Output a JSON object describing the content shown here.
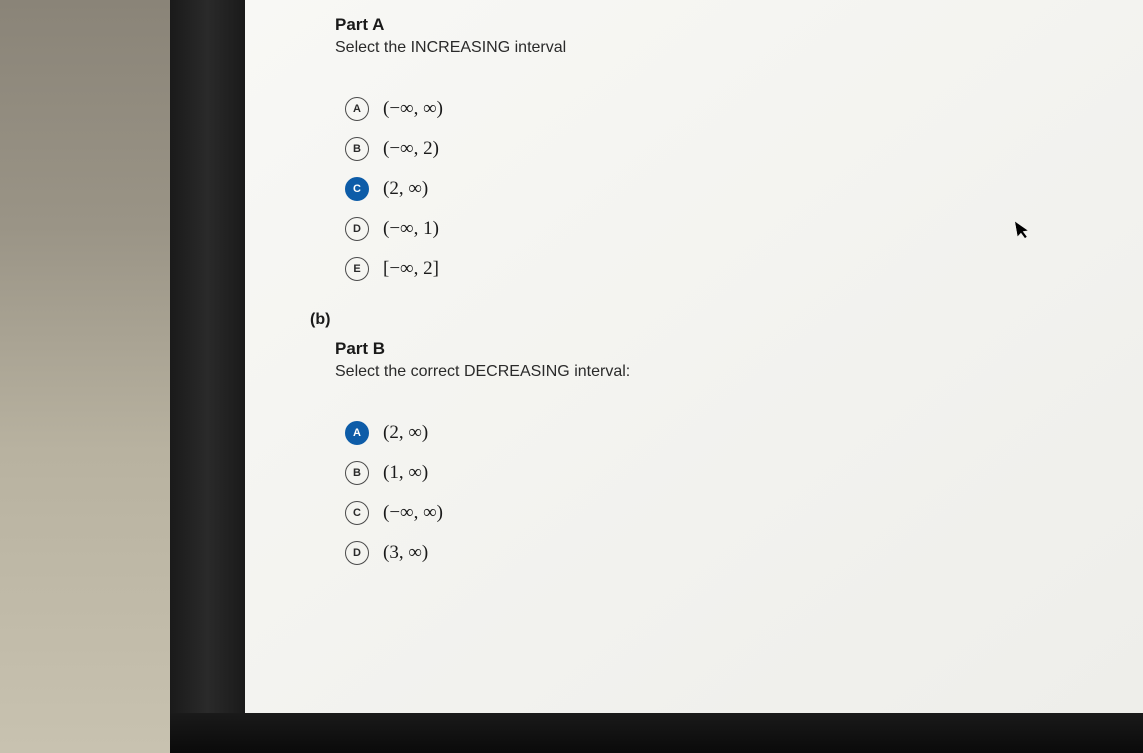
{
  "collapse_label": "<",
  "partA": {
    "title": "Part A",
    "prompt": "Select the INCREASING interval",
    "options": [
      {
        "letter": "A",
        "text": "(−∞, ∞)",
        "selected": false
      },
      {
        "letter": "B",
        "text": "(−∞, 2)",
        "selected": false
      },
      {
        "letter": "C",
        "text": "(2, ∞)",
        "selected": true
      },
      {
        "letter": "D",
        "text": "(−∞, 1)",
        "selected": false
      },
      {
        "letter": "E",
        "text": "[−∞, 2]",
        "selected": false
      }
    ]
  },
  "sectionB_label": "(b)",
  "partB": {
    "title": "Part B",
    "prompt": "Select the correct DECREASING interval:",
    "options": [
      {
        "letter": "A",
        "text": "(2, ∞)",
        "selected": true
      },
      {
        "letter": "B",
        "text": "(1, ∞)",
        "selected": false
      },
      {
        "letter": "C",
        "text": "(−∞, ∞)",
        "selected": false
      },
      {
        "letter": "D",
        "text": "(3, ∞)",
        "selected": false
      }
    ]
  }
}
